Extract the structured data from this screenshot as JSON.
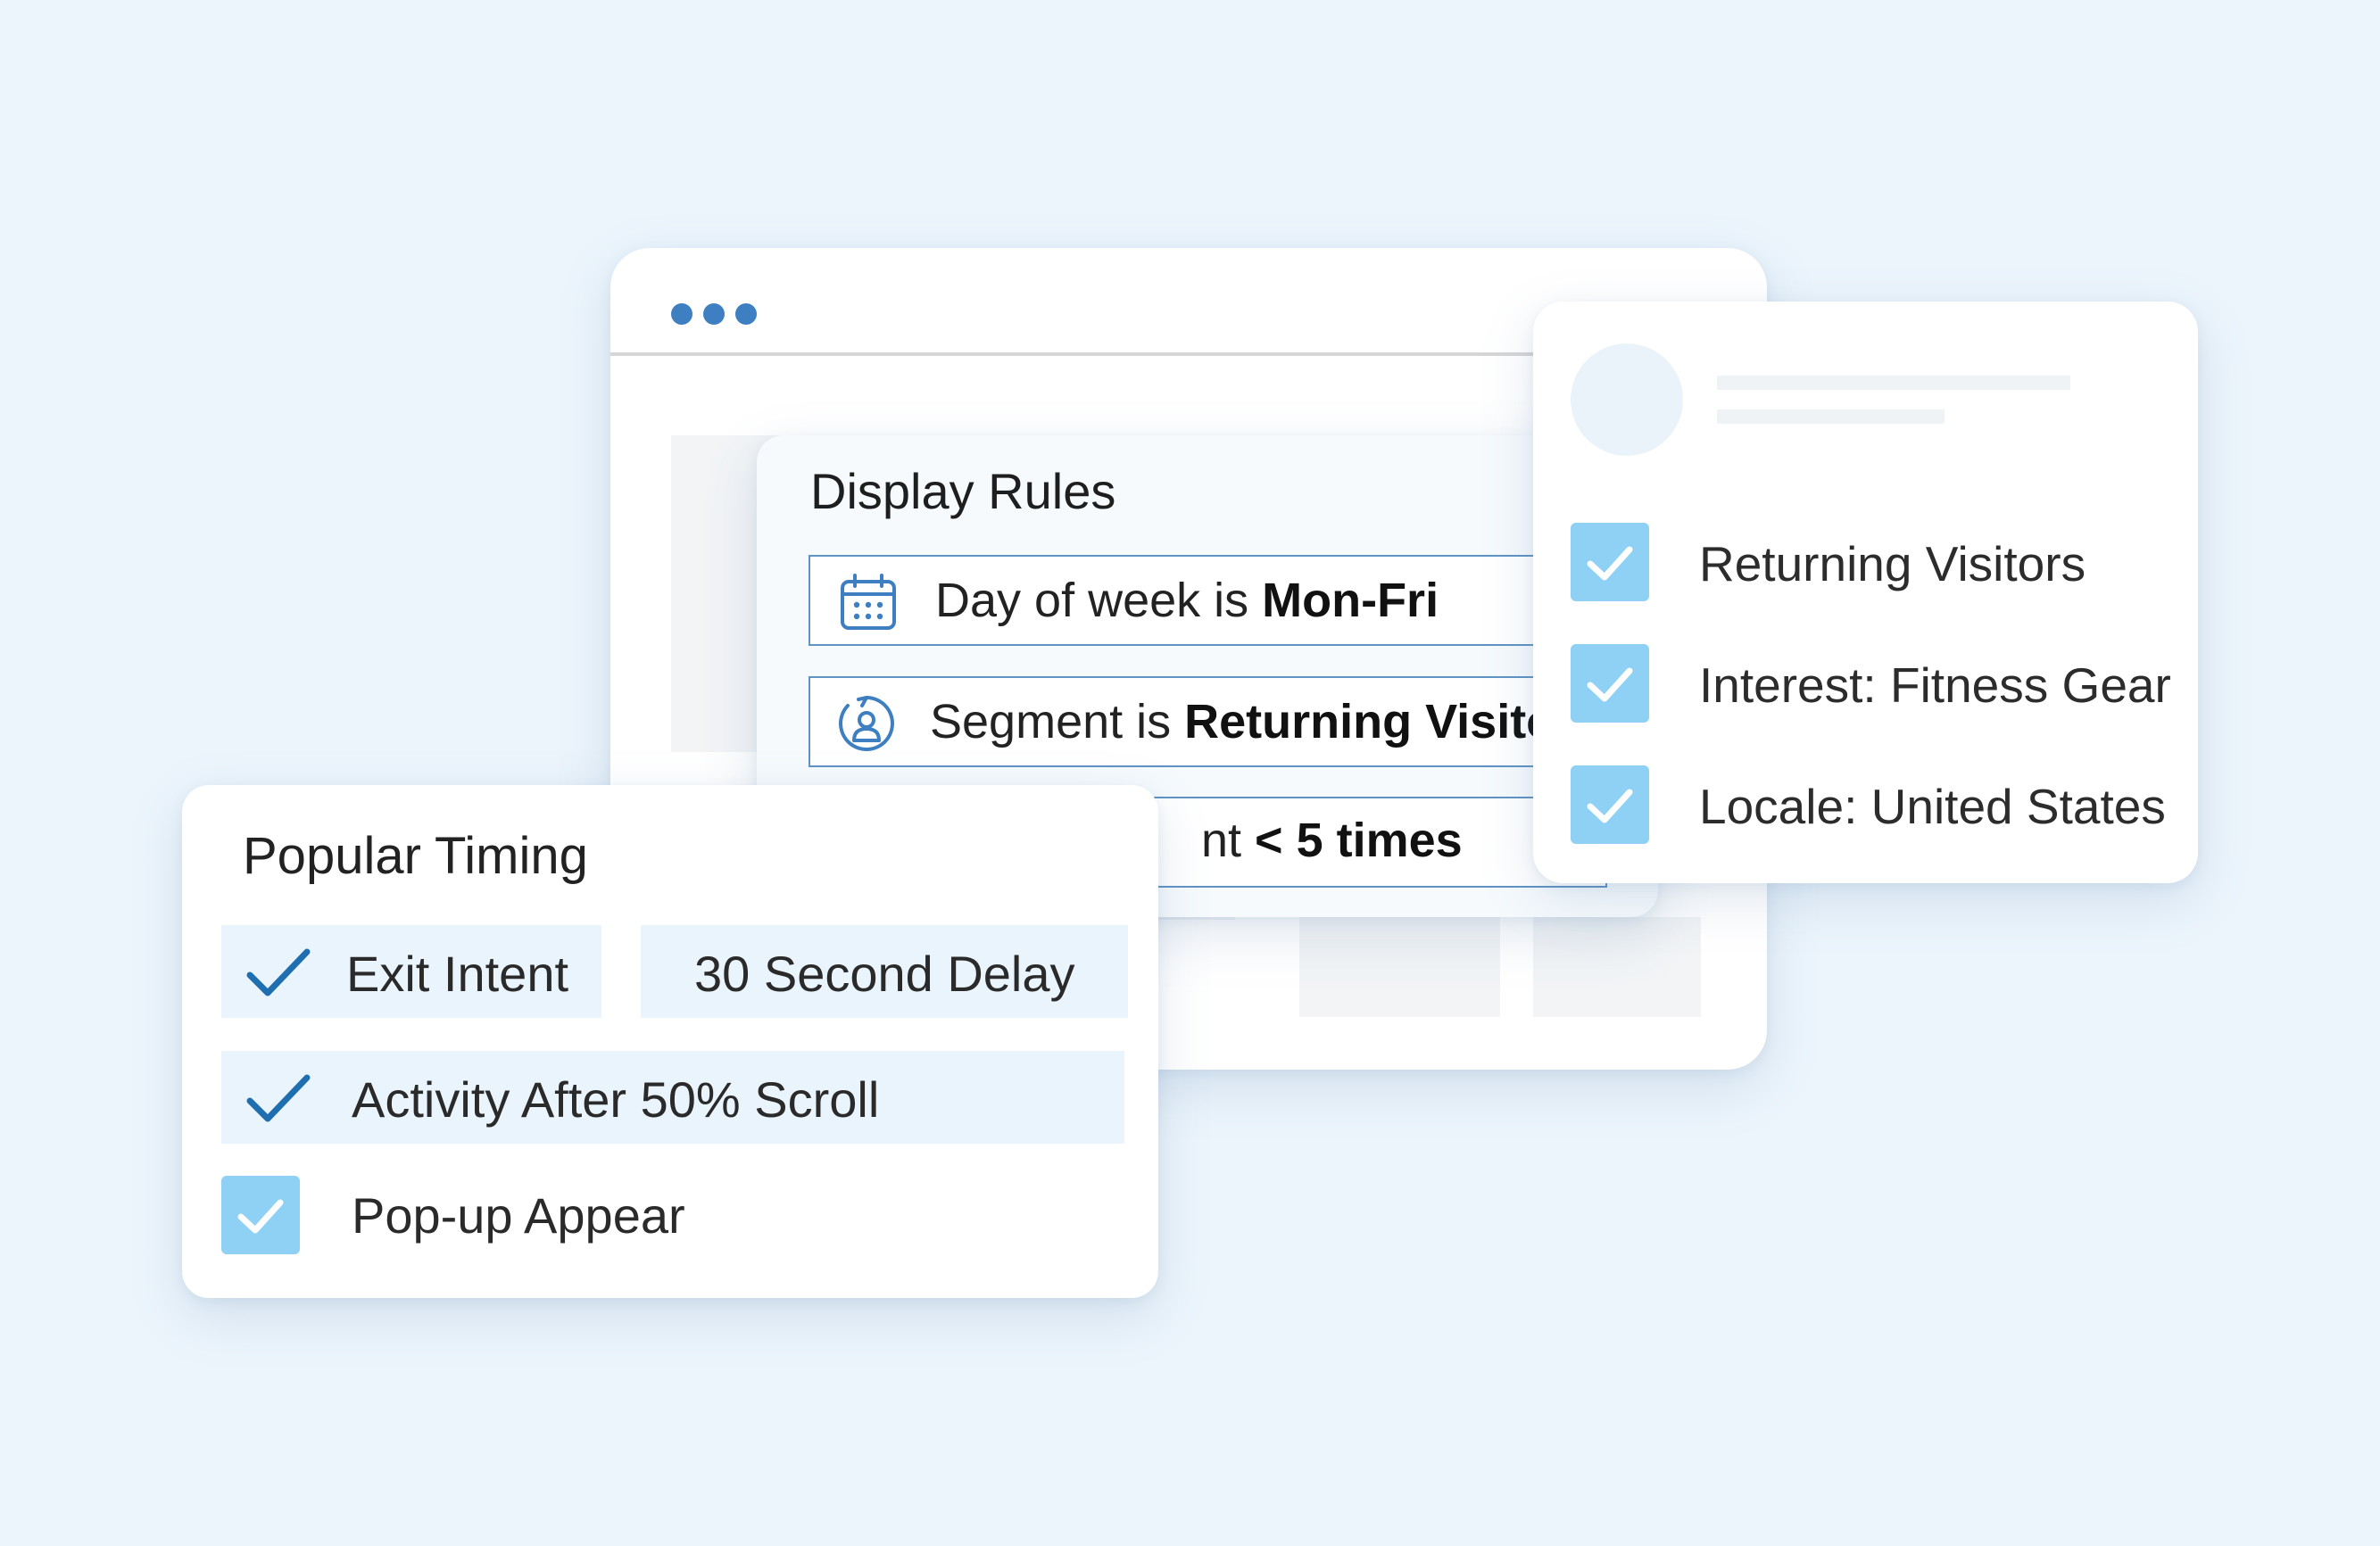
{
  "colors": {
    "background": "#ecf5fc",
    "accent_blue": "#3e7fc2",
    "checkbox_fill": "#8fd1f5",
    "chip_fill": "#eaf4fc",
    "rule_border": "#5f93c4"
  },
  "browser": {
    "window_controls": [
      "dot",
      "dot",
      "dot"
    ]
  },
  "display_rules": {
    "title": "Display Rules",
    "rules": [
      {
        "icon": "calendar-icon",
        "prefix": "Day of week is ",
        "value": "Mon-Fri"
      },
      {
        "icon": "returning-user-icon",
        "prefix": "Segment is ",
        "value": "Returning Visito"
      },
      {
        "icon": "",
        "prefix": "nt ",
        "value": "< 5 times"
      }
    ]
  },
  "segments": {
    "items": [
      {
        "label": "Returning Visitors",
        "checked": true
      },
      {
        "label": "Interest: Fitness Gear",
        "checked": true
      },
      {
        "label": "Locale: United States",
        "checked": true
      }
    ]
  },
  "popular_timing": {
    "title": "Popular Timing",
    "options": [
      {
        "label": "Exit Intent",
        "selected": true
      },
      {
        "label": "30 Second Delay",
        "selected": false
      },
      {
        "label": "Activity After 50% Scroll",
        "selected": true
      }
    ],
    "popup_checkbox": {
      "label": "Pop-up Appear",
      "checked": true
    }
  }
}
